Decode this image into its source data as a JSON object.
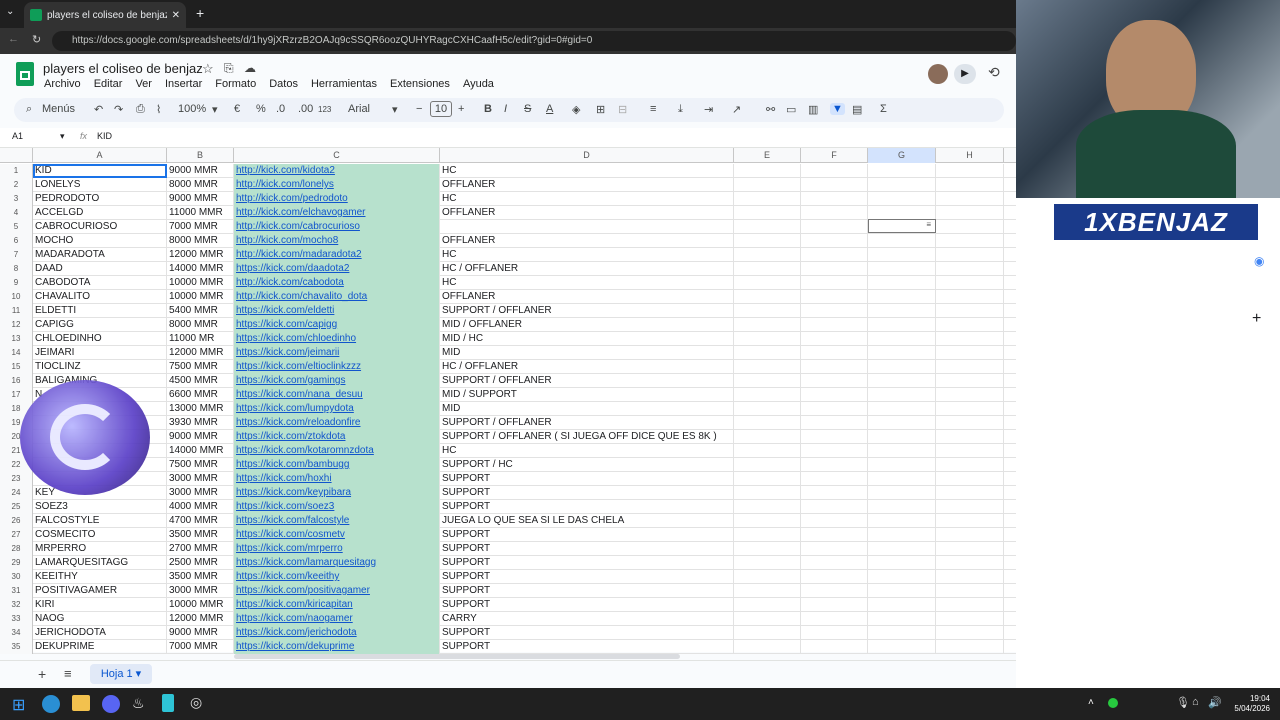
{
  "browser": {
    "tab_title": "players el coliseo de benjaz - Hoja",
    "url": "https://docs.google.com/spreadsheets/d/1hy9jXRzrzB2OAJq9cSSQR6oozQUHYRagcCXHCaafH5c/edit?gid=0#gid=0"
  },
  "doc": {
    "title": "players el coliseo de benjaz",
    "menus": [
      "Archivo",
      "Editar",
      "Ver",
      "Insertar",
      "Formato",
      "Datos",
      "Herramientas",
      "Extensiones",
      "Ayuda"
    ]
  },
  "toolbar": {
    "menus_label": "Menús",
    "zoom": "100%",
    "font": "Arial",
    "font_size": "10",
    "currency": "€",
    "percent": "%",
    "dec_dec": ".0",
    "inc_dec": ".00",
    "number_fmt": "123"
  },
  "formula": {
    "cell_ref": "A1",
    "fx": "fx",
    "value": "KID"
  },
  "columns": [
    "A",
    "B",
    "C",
    "D",
    "E",
    "F",
    "G",
    "H"
  ],
  "rows": [
    [
      "KID",
      "9000 MMR",
      "http://kick.com/kidota2",
      "HC"
    ],
    [
      "LONELYS",
      "8000 MMR",
      "http://kick.com/lonelys",
      "OFFLANER"
    ],
    [
      "PEDRODOTO",
      "9000 MMR",
      "http://kick.com/pedrodoto",
      "HC"
    ],
    [
      "ACCELGD",
      "11000 MMR",
      "http://kick.com/elchavogamer",
      "OFFLANER"
    ],
    [
      "CABROCURIOSO",
      "7000 MMR",
      "http://kick.com/cabrocurioso",
      ""
    ],
    [
      "MOCHO",
      "8000 MMR",
      "http://kick.com/mocho8",
      "OFFLANER"
    ],
    [
      "MADARADOTA",
      "12000 MMR",
      "http://kick.com/madaradota2",
      "HC"
    ],
    [
      "DAAD",
      "14000 MMR",
      "https://kick.com/daadota2",
      "HC / OFFLANER"
    ],
    [
      "CABODOTA",
      "10000 MMR",
      "http://kick.com/cabodota",
      "HC"
    ],
    [
      "CHAVALITO",
      "10000 MMR",
      "http://kick.com/chavalito_dota",
      "OFFLANER"
    ],
    [
      "ELDETTI",
      "5400 MMR",
      "https://kick.com/eldetti",
      "SUPPORT / OFFLANER"
    ],
    [
      "CAPIGG",
      "8000 MMR",
      "https://kick.com/capigg",
      "MID / OFFLANER"
    ],
    [
      "CHLOEDINHO",
      "11000 MR",
      "https://kick.com/chloedinho",
      "MID / HC"
    ],
    [
      "JEIMARI",
      "12000 MMR",
      "https://kick.com/jeimarii",
      "MID"
    ],
    [
      "TIOCLINZ",
      "7500 MMR",
      "https://kick.com/eltioclinkzzz",
      "HC / OFFLANER"
    ],
    [
      "BALIGAMING",
      "4500 MMR",
      "https://kick.com/gamings",
      "SUPPORT / OFFLANER"
    ],
    [
      "N",
      "6600 MMR",
      "https://kick.com/nana_desuu",
      "MID / SUPPORT"
    ],
    [
      "",
      "13000 MMR",
      "https://kick.com/lumpydota",
      "MID"
    ],
    [
      "",
      "3930 MMR",
      "https://kick.com/reloadonfire",
      "SUPPORT / OFFLANER"
    ],
    [
      "",
      "9000 MMR",
      "https://kick.com/ztokdota",
      "SUPPORT / OFFLANER ( SI JUEGA OFF DICE QUE ES 8K )"
    ],
    [
      "",
      "14000 MMR",
      "https://kick.com/kotaromnzdota",
      "HC"
    ],
    [
      "",
      "7500 MMR",
      "https://kick.com/bambugg",
      "SUPPORT / HC"
    ],
    [
      "",
      "3000 MMR",
      "https://kick.com/hoxhi",
      "SUPPORT"
    ],
    [
      "KEY",
      "3000 MMR",
      "https://kick.com/keypibara",
      "SUPPORT"
    ],
    [
      "SOEZ3",
      "4000 MMR",
      "https://kick.com/soez3",
      "SUPPORT"
    ],
    [
      "FALCOSTYLE",
      "4700 MMR",
      "https://kick.com/falcostyle",
      "JUEGA LO QUE SEA  SI LE DAS CHELA"
    ],
    [
      "COSMECITO",
      "3500 MMR",
      "https://kick.com/cosmetv",
      "SUPPORT"
    ],
    [
      "MRPERRO",
      "2700 MMR",
      "https://kick.com/mrperro",
      "SUPPORT"
    ],
    [
      "LAMARQUESITAGG",
      "2500 MMR",
      "https://kick.com/lamarquesitagg",
      "SUPPORT"
    ],
    [
      "KEEITHY",
      "3500 MMR",
      "https://kick.com/keeithy",
      "SUPPORT"
    ],
    [
      "POSITIVAGAMER",
      "3000 MMR",
      "https://kick.com/positivagamer",
      "SUPPORT"
    ],
    [
      "KIRI",
      "10000 MMR",
      "https://kick.com/kiricapitan",
      "SUPPORT"
    ],
    [
      "NAOG",
      "12000 MMR",
      "https://kick.com/naogamer",
      "CARRY"
    ],
    [
      "JERICHODOTA",
      "9000 MMR",
      "https://kick.com/jerichodota",
      "SUPPORT"
    ],
    [
      "DEKUPRIME",
      "7000 MMR",
      "https://kick.com/dekuprime",
      "SUPPORT"
    ]
  ],
  "sheet": {
    "tab": "Hoja 1"
  },
  "overlay": {
    "logo_text": "1XBENJAZ"
  },
  "taskbar": {
    "time": "19:04",
    "date": "5/04/2026"
  }
}
